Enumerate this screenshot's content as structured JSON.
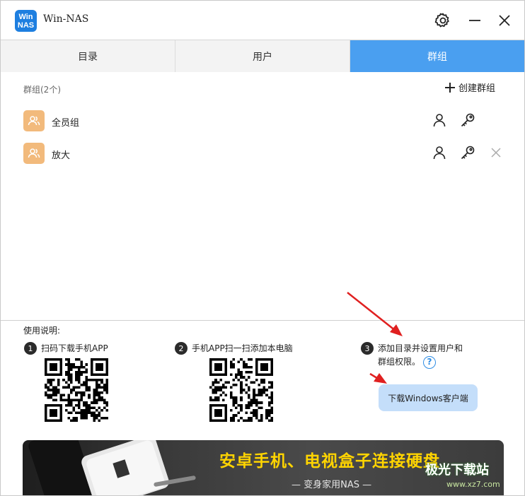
{
  "app": {
    "logo_line1": "Win",
    "logo_line2": "NAS",
    "title": "Win-NAS"
  },
  "titlebar": {
    "settings_icon": "gear-icon",
    "minimize_icon": "minimize-icon",
    "close_icon": "close-icon"
  },
  "tabs": [
    {
      "label": "目录",
      "active": false
    },
    {
      "label": "用户",
      "active": false
    },
    {
      "label": "群组",
      "active": true
    }
  ],
  "colors": {
    "accent": "#4a9ff0",
    "avatar": "#f2ba7c",
    "logo": "#1e7fe0",
    "banner_text": "#ffd400"
  },
  "groups": {
    "header": "群组(2个)",
    "create_label": "创建群组",
    "items": [
      {
        "name": "全员组",
        "deletable": false
      },
      {
        "name": "放大",
        "deletable": true
      }
    ]
  },
  "instructions": {
    "title": "使用说明:",
    "steps": [
      {
        "num": "1",
        "text": "扫码下载手机APP"
      },
      {
        "num": "2",
        "text": "手机APP扫一扫添加本电脑"
      },
      {
        "num": "3",
        "text_line1": "添加目录并设置用户和",
        "text_line2": "群组权限。"
      }
    ],
    "help": "?",
    "download_label": "下载Windows客户端"
  },
  "banner": {
    "title": "安卓手机、电视盒子连接硬盘",
    "subtitle": "— 变身家用NAS —"
  },
  "watermark": {
    "text": "极光下载站",
    "url": "www.xz7.com"
  }
}
